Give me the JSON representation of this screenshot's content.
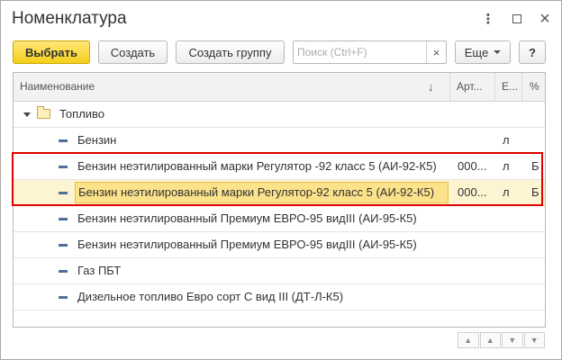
{
  "window": {
    "title": "Номенклатура",
    "more_icon": "⋮",
    "close_icon": "×"
  },
  "toolbar": {
    "select_label": "Выбрать",
    "create_label": "Создать",
    "create_group_label": "Создать группу",
    "search_placeholder": "Поиск (Ctrl+F)",
    "search_value": "",
    "search_clear": "×",
    "more_label": "Еще",
    "help_label": "?"
  },
  "grid": {
    "headers": {
      "name": "Наименование",
      "sort_icon": "↓",
      "article": "Арт...",
      "unit": "Е...",
      "pct": "%"
    },
    "folder": {
      "name": "Топливо"
    },
    "rows": [
      {
        "name": "Бензин",
        "article": "",
        "unit": "л",
        "pct": ""
      },
      {
        "name": "Бензин неэтилированный марки Регулятор -92 класс 5 (АИ-92-К5)",
        "article": "000...",
        "unit": "л",
        "pct": "Б"
      },
      {
        "name": "Бензин неэтилированный марки Регулятор-92 класс 5 (АИ-92-К5)",
        "article": "000...",
        "unit": "л",
        "pct": "Б"
      },
      {
        "name": "Бензин неэтилированный Премиум ЕВРО-95 видIII (АИ-95-К5)",
        "article": "",
        "unit": "",
        "pct": ""
      },
      {
        "name": "Бензин неэтилированный Премиум ЕВРО-95 видIII (АИ-95-К5)",
        "article": "",
        "unit": "",
        "pct": ""
      },
      {
        "name": "Газ ПБТ",
        "article": "",
        "unit": "",
        "pct": ""
      },
      {
        "name": "Дизельное топливо Евро сорт С вид III (ДТ-Л-К5)",
        "article": "",
        "unit": "",
        "pct": ""
      }
    ]
  },
  "pager": {
    "first": "▲",
    "prev": "▲",
    "next": "▼",
    "last": "▼"
  },
  "colors": {
    "primary_button": "#f5cf1a",
    "selection": "#fbe28b",
    "highlight_frame": "#e00000",
    "item_icon": "#4f6f9a"
  }
}
